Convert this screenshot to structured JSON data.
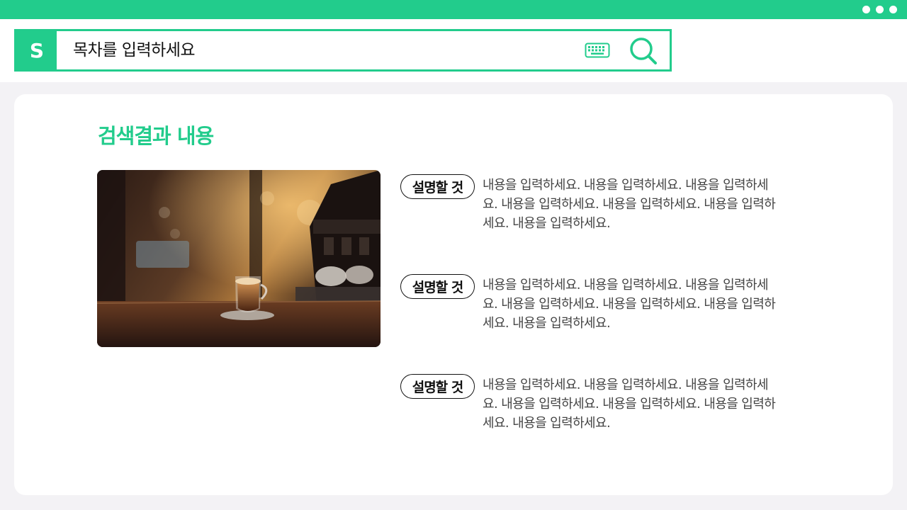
{
  "window": {
    "controls": [
      "dot",
      "dot",
      "dot"
    ]
  },
  "search": {
    "placeholder": "목차를 입력하세요",
    "logo_letter": "S",
    "icons": [
      "keyboard-icon",
      "search-icon"
    ]
  },
  "colors": {
    "accent": "#22cc8c",
    "background": "#f3f2f5",
    "card": "#ffffff",
    "text": "#444444"
  },
  "main": {
    "title": "검색결과 내용",
    "image": "cafe-coffee-photo",
    "items": [
      {
        "label": "설명할 것",
        "text": "내용을 입력하세요. 내용을 입력하세요. 내용을 입력하세요. 내용을 입력하세요. 내용을 입력하세요. 내용을 입력하세요. 내용을 입력하세요."
      },
      {
        "label": "설명할 것",
        "text": "내용을 입력하세요. 내용을 입력하세요. 내용을 입력하세요. 내용을 입력하세요. 내용을 입력하세요. 내용을 입력하세요. 내용을 입력하세요."
      },
      {
        "label": "설명할 것",
        "text": "내용을 입력하세요. 내용을 입력하세요. 내용을 입력하세요. 내용을 입력하세요. 내용을 입력하세요. 내용을 입력하세요. 내용을 입력하세요."
      }
    ]
  }
}
